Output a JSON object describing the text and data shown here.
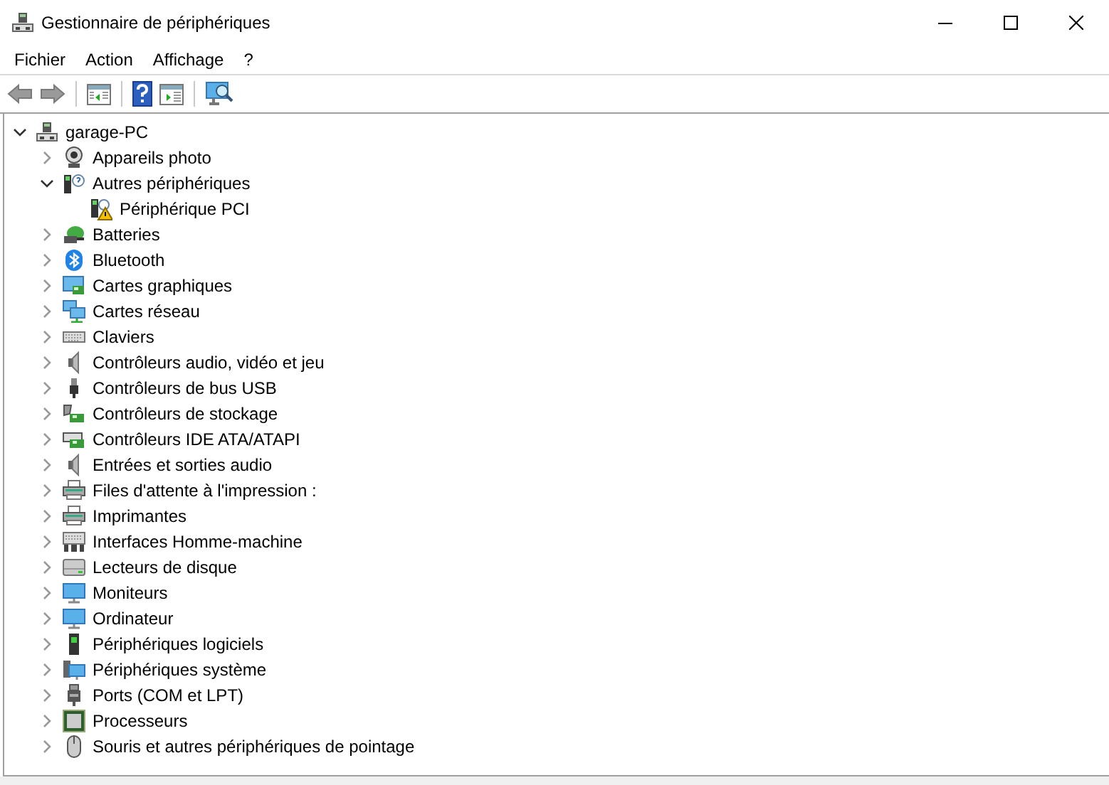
{
  "window": {
    "title": "Gestionnaire de périphériques"
  },
  "menu": [
    {
      "label": "Fichier"
    },
    {
      "label": "Action"
    },
    {
      "label": "Affichage"
    },
    {
      "label": "?"
    }
  ],
  "tree": {
    "label": "garage-PC",
    "expanded": true,
    "children": [
      {
        "label": "Appareils photo",
        "expanded": false
      },
      {
        "label": "Autres périphériques",
        "expanded": true,
        "children": [
          {
            "label": "Périphérique PCI"
          }
        ]
      },
      {
        "label": "Batteries",
        "expanded": false
      },
      {
        "label": "Bluetooth",
        "expanded": false
      },
      {
        "label": "Cartes graphiques",
        "expanded": false
      },
      {
        "label": "Cartes réseau",
        "expanded": false
      },
      {
        "label": "Claviers",
        "expanded": false
      },
      {
        "label": "Contrôleurs audio, vidéo et jeu",
        "expanded": false
      },
      {
        "label": "Contrôleurs de bus USB",
        "expanded": false
      },
      {
        "label": "Contrôleurs de stockage",
        "expanded": false
      },
      {
        "label": "Contrôleurs IDE ATA/ATAPI",
        "expanded": false
      },
      {
        "label": "Entrées et sorties audio",
        "expanded": false
      },
      {
        "label": "Files d'attente à l'impression :",
        "expanded": false
      },
      {
        "label": "Imprimantes",
        "expanded": false
      },
      {
        "label": "Interfaces Homme-machine",
        "expanded": false
      },
      {
        "label": "Lecteurs de disque",
        "expanded": false
      },
      {
        "label": "Moniteurs",
        "expanded": false
      },
      {
        "label": "Ordinateur",
        "expanded": false
      },
      {
        "label": "Périphériques logiciels",
        "expanded": false
      },
      {
        "label": "Périphériques système",
        "expanded": false
      },
      {
        "label": "Ports (COM et LPT)",
        "expanded": false
      },
      {
        "label": "Processeurs",
        "expanded": false
      },
      {
        "label": "Souris et autres périphériques de pointage",
        "expanded": false
      }
    ]
  }
}
